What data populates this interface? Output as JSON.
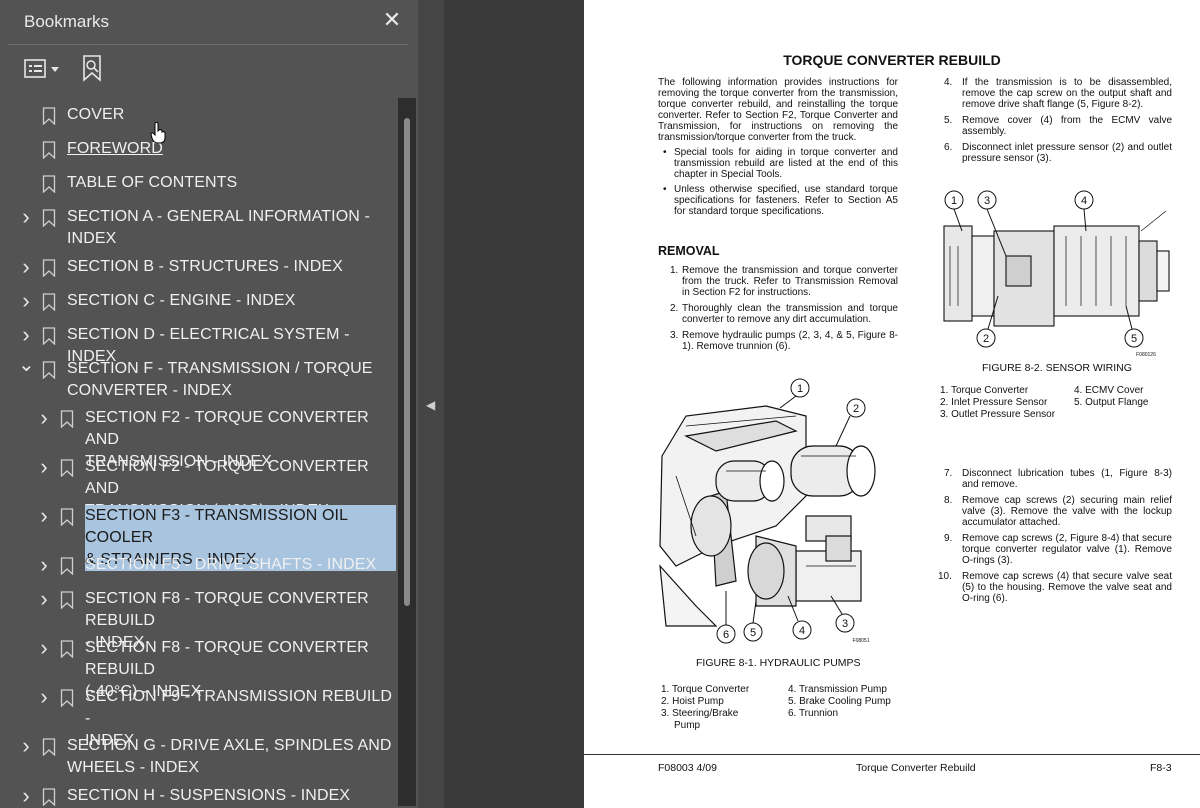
{
  "bookmarks_panel": {
    "title": "Bookmarks",
    "close_icon": "close-icon",
    "options_icon": "bookmark-options-icon",
    "add_icon": "add-bookmark-icon",
    "items": [
      {
        "label": "COVER",
        "level": 0,
        "expandable": false
      },
      {
        "label": "FOREWORD",
        "level": 0,
        "expandable": false,
        "hovered": true
      },
      {
        "label": "TABLE OF CONTENTS",
        "level": 0,
        "expandable": false
      },
      {
        "label": "SECTION A - GENERAL INFORMATION -",
        "label2": "INDEX",
        "level": 0,
        "expandable": true
      },
      {
        "label": "SECTION B - STRUCTURES - INDEX",
        "level": 0,
        "expandable": true
      },
      {
        "label": "SECTION C - ENGINE - INDEX",
        "level": 0,
        "expandable": true
      },
      {
        "label": "SECTION D - ELECTRICAL SYSTEM - INDEX",
        "level": 0,
        "expandable": true
      },
      {
        "label": "SECTION F - TRANSMISSION / TORQUE",
        "label2": "CONVERTER - INDEX",
        "level": 0,
        "expandable": true,
        "expanded": true
      },
      {
        "label": "SECTION F2 - TORQUE CONVERTER AND",
        "label2": "TRANSMISSION - INDEX",
        "level": 1,
        "expandable": true
      },
      {
        "label": "SECTION F2 - TORQUE CONVERTER AND",
        "label2": "TRANSMISSION (-40°C) - INDEX",
        "level": 1,
        "expandable": true
      },
      {
        "label": "SECTION F3 - TRANSMISSION OIL COOLER",
        "label2": "& STRAINERS - INDEX",
        "level": 1,
        "expandable": true,
        "selected": true
      },
      {
        "label": "SECTION F5 - DRIVE SHAFTS - INDEX",
        "level": 1,
        "expandable": true
      },
      {
        "label": "SECTION F8 - TORQUE CONVERTER REBUILD",
        "label2": "- INDEX",
        "level": 1,
        "expandable": true
      },
      {
        "label": "SECTION F8 - TORQUE CONVERTER REBUILD",
        "label2": "(-40°C) - INDEX",
        "level": 1,
        "expandable": true
      },
      {
        "label": "SECTION F9 - TRANSMISSION REBUILD -",
        "label2": "INDEX",
        "level": 1,
        "expandable": true
      },
      {
        "label": "SECTION G - DRIVE AXLE, SPINDLES AND",
        "label2": "WHEELS - INDEX",
        "level": 0,
        "expandable": true
      },
      {
        "label": "SECTION H - SUSPENSIONS - INDEX",
        "level": 0,
        "expandable": true
      }
    ]
  },
  "document": {
    "title": "TORQUE CONVERTER REBUILD",
    "intro": "The following information provides instructions for removing the torque converter from the transmission, torque converter rebuild, and reinstalling the torque converter. Refer to Section F2, Torque Converter and Transmission, for instructions on removing the transmission/torque converter from the truck.",
    "bullets": [
      "Special tools for aiding in torque converter and transmission rebuild are listed at the end of this chapter in Special Tools.",
      "Unless otherwise specified, use standard torque specifications for fasteners. Refer to Section A5 for standard torque specifications."
    ],
    "removal_heading": "REMOVAL",
    "removal_steps": [
      "Remove the transmission and torque converter from the truck. Refer to Transmission Removal in Section F2 for instructions.",
      "Thoroughly clean the transmission and torque converter to remove any dirt accumulation.",
      "Remove hydraulic pumps (2, 3, 4, & 5, Figure 8-1). Remove trunnion (6)."
    ],
    "right_steps_a": [
      {
        "n": "4.",
        "text": "If the transmission is to be disassembled, remove the cap screw on the output shaft and remove drive shaft flange (5, Figure 8-2)."
      },
      {
        "n": "5.",
        "text": "Remove cover (4) from the ECMV valve assembly."
      },
      {
        "n": "6.",
        "text": "Disconnect inlet pressure sensor (2) and outlet pressure sensor (3)."
      }
    ],
    "right_steps_b": [
      {
        "n": "7.",
        "text": "Disconnect lubrication tubes (1, Figure 8-3) and remove."
      },
      {
        "n": "8.",
        "text": "Remove cap screws (2) securing main relief valve (3). Remove the valve with the lockup accumulator attached."
      },
      {
        "n": "9.",
        "text": "Remove cap screws (2, Figure 8-4) that secure torque converter regulator valve (1). Remove O-rings (3)."
      },
      {
        "n": "10.",
        "text": "Remove cap screws (4) that secure valve seat (5) to the housing. Remove the valve seat and O-ring (6)."
      }
    ],
    "figure1": {
      "caption": "FIGURE 8-1. HYDRAULIC PUMPS",
      "code": "F08051",
      "callouts": [
        "1",
        "2",
        "3",
        "4",
        "5",
        "6"
      ],
      "legend_left": [
        "1. Torque Converter",
        "2. Hoist Pump",
        "3. Steering/Brake",
        "Pump"
      ],
      "legend_right": [
        "4. Transmission Pump",
        "5. Brake Cooling Pump",
        "6. Trunnion"
      ]
    },
    "figure2": {
      "caption": "FIGURE 8-2. SENSOR WIRING",
      "code": "F080126",
      "callouts": [
        "1",
        "3",
        "4",
        "2",
        "5"
      ],
      "legend_left": [
        "1. Torque Converter",
        "2. Inlet Pressure Sensor",
        "3. Outlet Pressure Sensor"
      ],
      "legend_right": [
        "4. ECMV Cover",
        "5. Output Flange"
      ]
    },
    "footer": {
      "left": "F08003   4/09",
      "center": "Torque Converter Rebuild",
      "right": "F8-3"
    }
  }
}
